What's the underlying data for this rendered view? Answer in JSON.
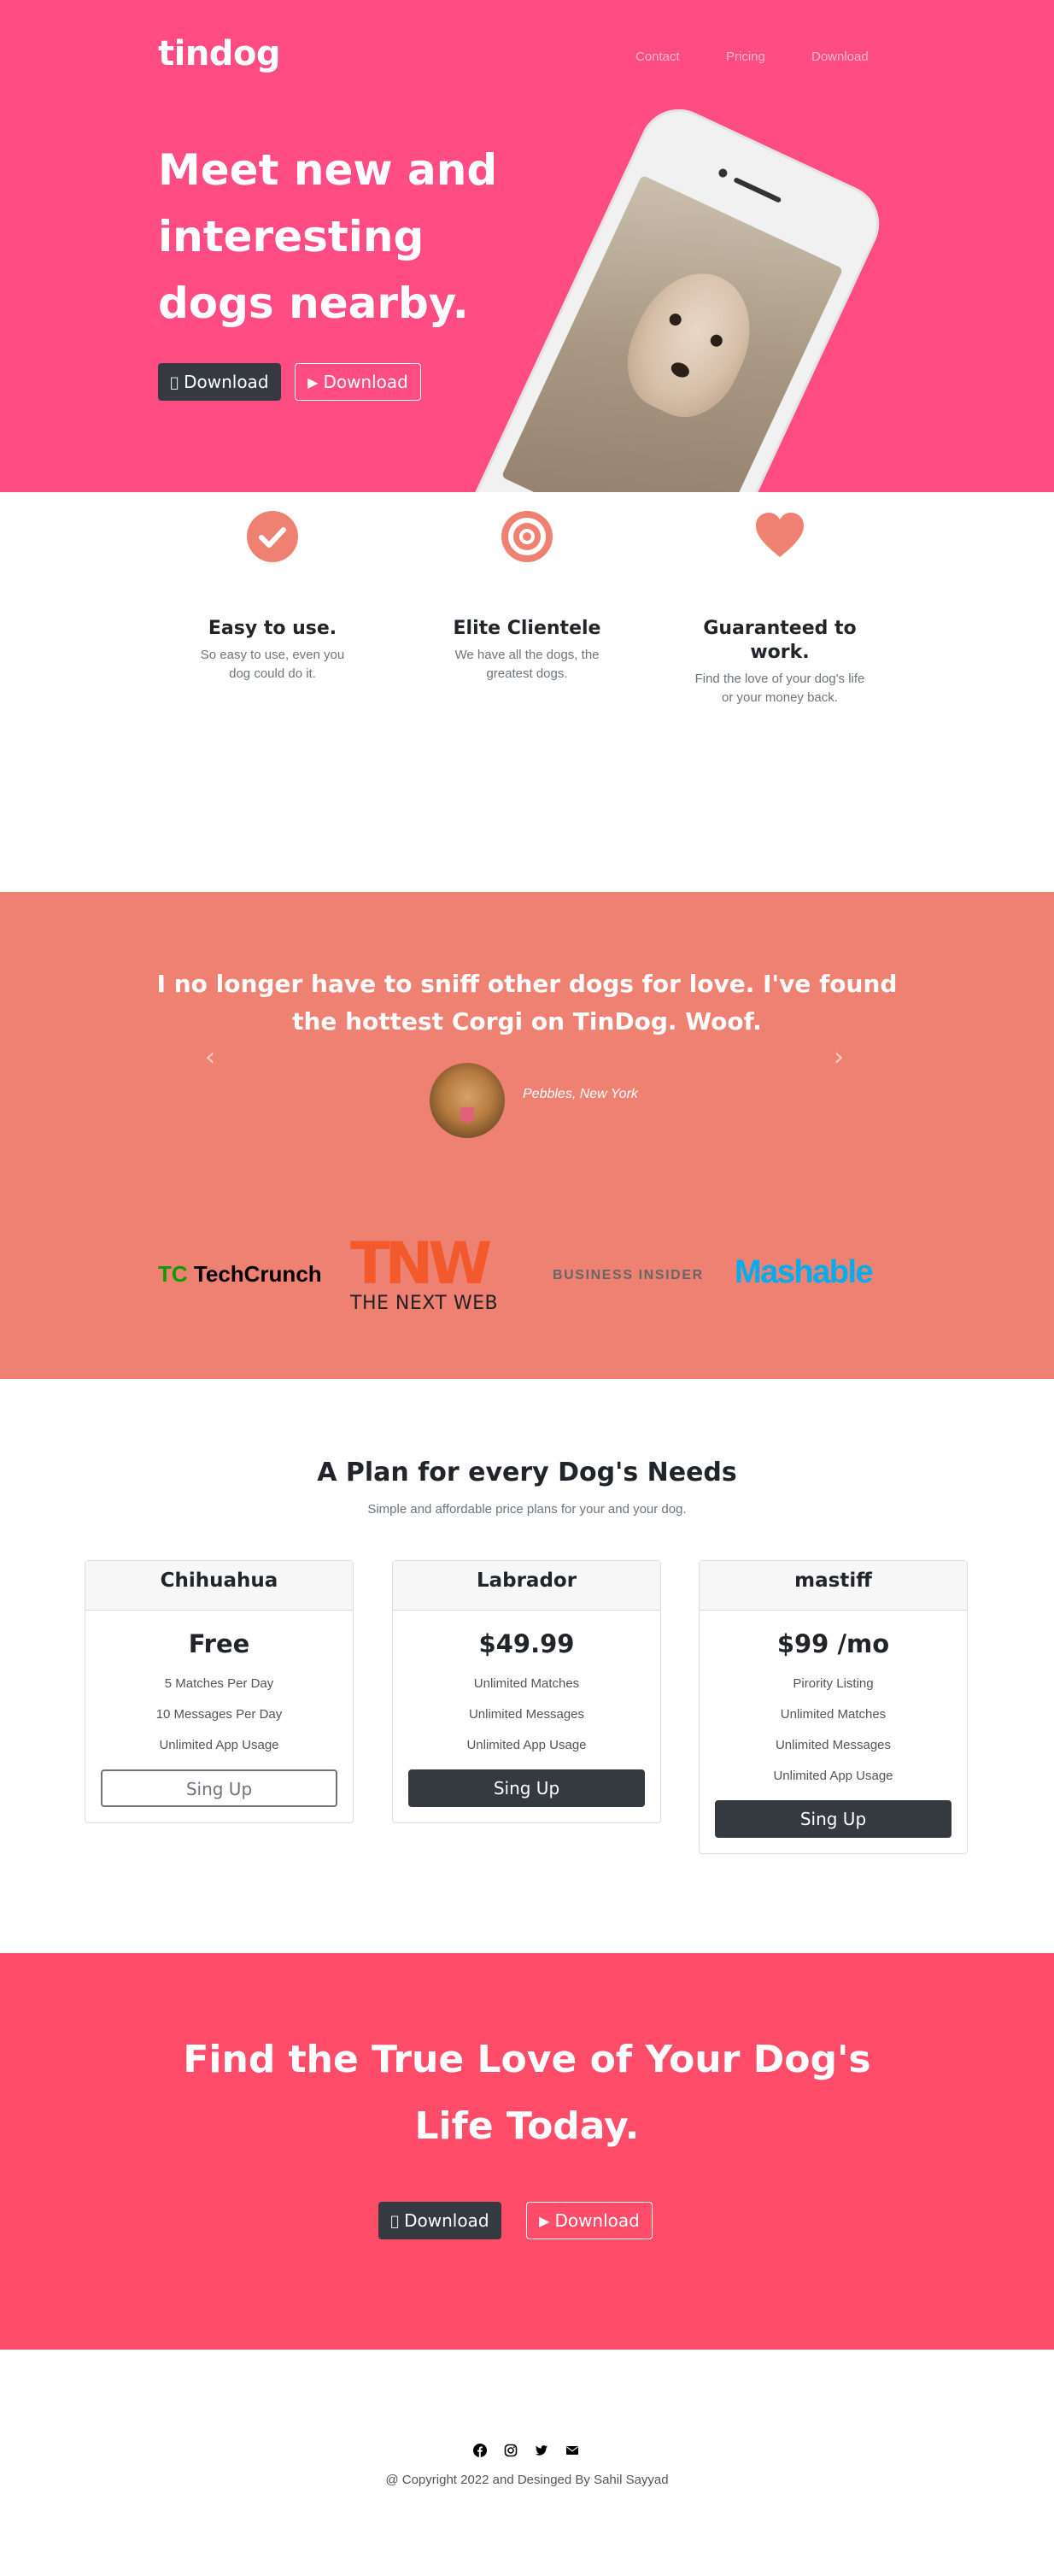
{
  "brand": "tindog",
  "nav": [
    "Contact",
    "Pricing",
    "Download"
  ],
  "hero": {
    "title": "Meet new and interesting dogs nearby.",
    "apple_download": "Download",
    "play_download": "Download"
  },
  "features": [
    {
      "icon": "check-circle-icon",
      "title": "Easy to use.",
      "text": "So easy to use, even you dog could do it."
    },
    {
      "icon": "bullseye-icon",
      "title": "Elite Clientele",
      "text": "We have all the dogs, the greatest dogs."
    },
    {
      "icon": "heart-icon",
      "title": "Guaranteed to work.",
      "text": "Find the love of your dog's life or your money back."
    }
  ],
  "testimonial": {
    "quote": "I no longer have to sniff other dogs for love. I've found the hottest Corgi on TinDog. Woof.",
    "author": "Pebbles, New York"
  },
  "press": [
    {
      "name": "TechCrunch",
      "mark": "TC"
    },
    {
      "name": "THE NEXT WEB",
      "mark": "TNW"
    },
    {
      "name": "BUSINESS INSIDER"
    },
    {
      "name": "Mashable"
    }
  ],
  "pricing": {
    "title": "A Plan for every Dog's Needs",
    "subtitle": "Simple and affordable price plans for your and your dog.",
    "plans": [
      {
        "name": "Chihuahua",
        "price": "Free",
        "features": [
          "5 Matches Per Day",
          "10 Messages Per Day",
          "Unlimited App Usage"
        ],
        "button": "Sing Up"
      },
      {
        "name": "Labrador",
        "price": "$49.99",
        "features": [
          "Unlimited Matches",
          "Unlimited Messages",
          "Unlimited App Usage"
        ],
        "button": "Sing Up"
      },
      {
        "name": "mastiff",
        "price": "$99 /mo",
        "features": [
          "Pirority Listing",
          "Unlimited Matches",
          "Unlimited Messages",
          "Unlimited App Usage"
        ],
        "button": "Sing Up"
      }
    ]
  },
  "cta": {
    "title": "Find the True Love of Your Dog's Life Today.",
    "apple_download": "Download",
    "play_download": "Download"
  },
  "footer": {
    "social": [
      "facebook-icon",
      "instagram-icon",
      "twitter-icon",
      "envelope-icon"
    ],
    "copyright": "@ Copyright 2022 and Desinged By Sahil Sayyad"
  },
  "colors": {
    "hero_bg": "#ff4c83",
    "testimonial_bg": "#ef8172",
    "cta_bg": "#ff4c68",
    "icon_accent": "#ef8172",
    "dark_button": "#343a40"
  }
}
